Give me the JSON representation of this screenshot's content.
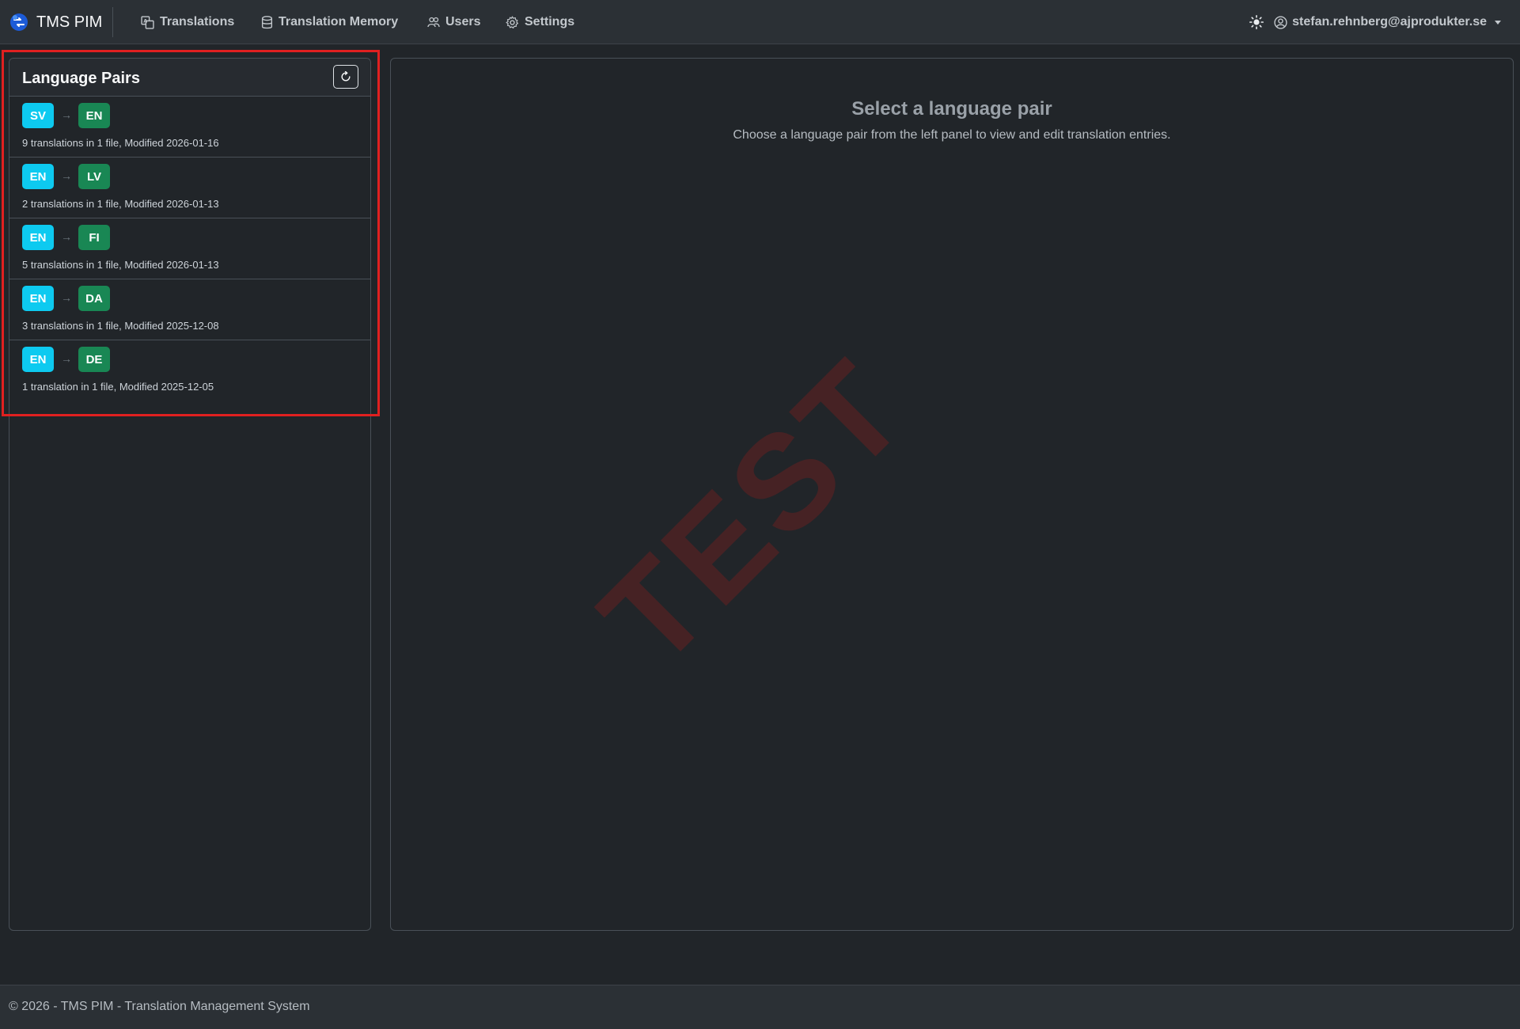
{
  "navbar": {
    "brand": "TMS PIM",
    "items": [
      {
        "label": "Translations",
        "icon": "translate-icon"
      },
      {
        "label": "Translation Memory",
        "icon": "database-icon"
      },
      {
        "label": "Users",
        "icon": "users-icon"
      },
      {
        "label": "Settings",
        "icon": "gear-icon"
      }
    ],
    "theme_icon": "sun-icon",
    "user": "stefan.rehnberg@ajprodukter.se"
  },
  "left_panel": {
    "title": "Language Pairs",
    "refresh_icon": "refresh-icon",
    "pairs": [
      {
        "source": "SV",
        "target": "EN",
        "info": "9 translations in 1 file, Modified 2026-01-16"
      },
      {
        "source": "EN",
        "target": "LV",
        "info": "2 translations in 1 file, Modified 2026-01-13"
      },
      {
        "source": "EN",
        "target": "FI",
        "info": "5 translations in 1 file, Modified 2026-01-13"
      },
      {
        "source": "EN",
        "target": "DA",
        "info": "3 translations in 1 file, Modified 2025-12-08"
      },
      {
        "source": "EN",
        "target": "DE",
        "info": "1 translation in 1 file, Modified 2025-12-05"
      }
    ]
  },
  "main": {
    "empty_title": "Select a language pair",
    "empty_subtitle": "Choose a language pair from the left panel to view and edit translation entries.",
    "watermark": "TEST"
  },
  "footer": {
    "text": "© 2026 - TMS PIM - Translation Management System"
  },
  "colors": {
    "background": "#212529",
    "navbar": "#2b3035",
    "source_badge": "#0dcaf0",
    "target_badge": "#198754",
    "highlight": "#e02020",
    "watermark": "#961c1c"
  }
}
